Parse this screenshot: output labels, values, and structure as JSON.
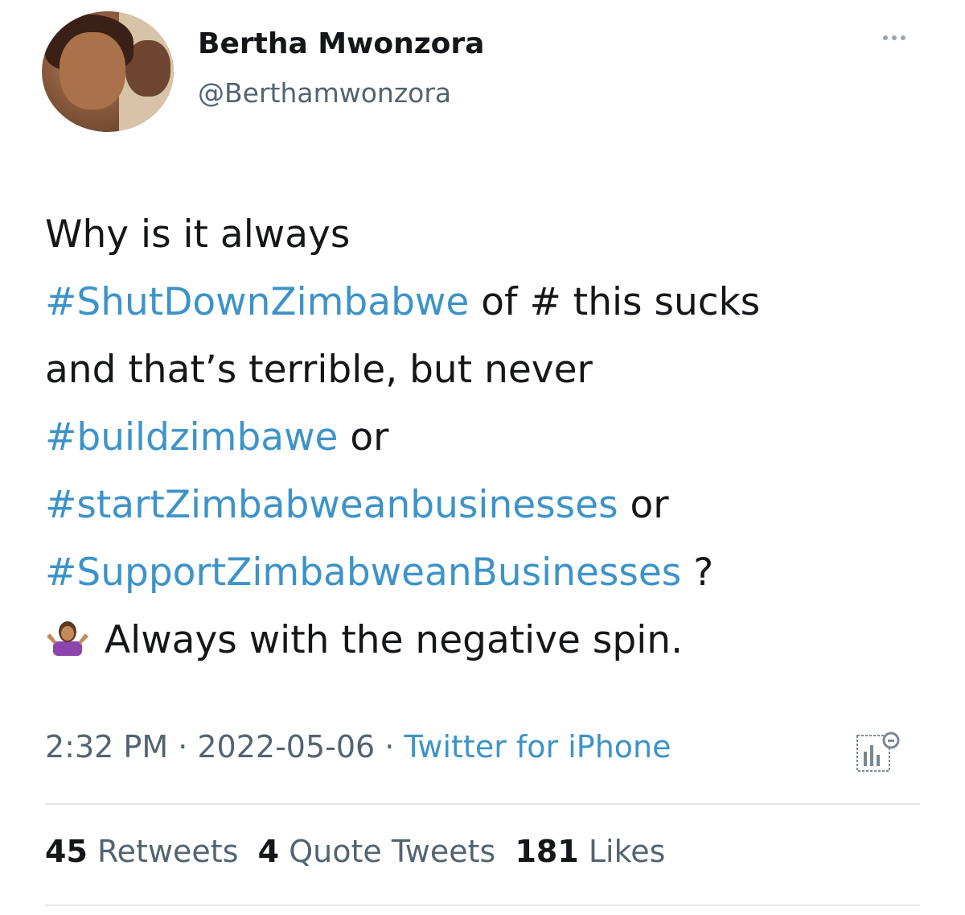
{
  "user": {
    "name": "Bertha Mwonzora",
    "handle": "@Berthamwonzora"
  },
  "tweet": {
    "line1": "Why is it always",
    "tag1": "#ShutDownZimbabwe",
    "line2_rest": " of # this sucks",
    "line3": "and that’s terrible, but never",
    "tag2": "#buildzimbawe",
    "line4_rest": " or",
    "tag3": "#startZimbabweanbusinesses",
    "line5_rest": " or",
    "tag4": "#SupportZimbabweanBusinesses",
    "line6_rest": " ?",
    "line7": "Always with the negative spin."
  },
  "meta": {
    "time": "2:32 PM",
    "sep1": " · ",
    "date": "2022-05-06",
    "sep2": " · ",
    "source": "Twitter for iPhone"
  },
  "stats": {
    "retweets_count": "45",
    "retweets_label": "Retweets",
    "quotes_count": "4",
    "quotes_label": "Quote Tweets",
    "likes_count": "181",
    "likes_label": "Likes"
  },
  "icons": {
    "more": "more-icon",
    "emoji": "person-shrugging-emoji",
    "analytics": "analytics-icon"
  },
  "colors": {
    "link": "#3d93c9",
    "text": "#141619",
    "secondary": "#536471"
  }
}
